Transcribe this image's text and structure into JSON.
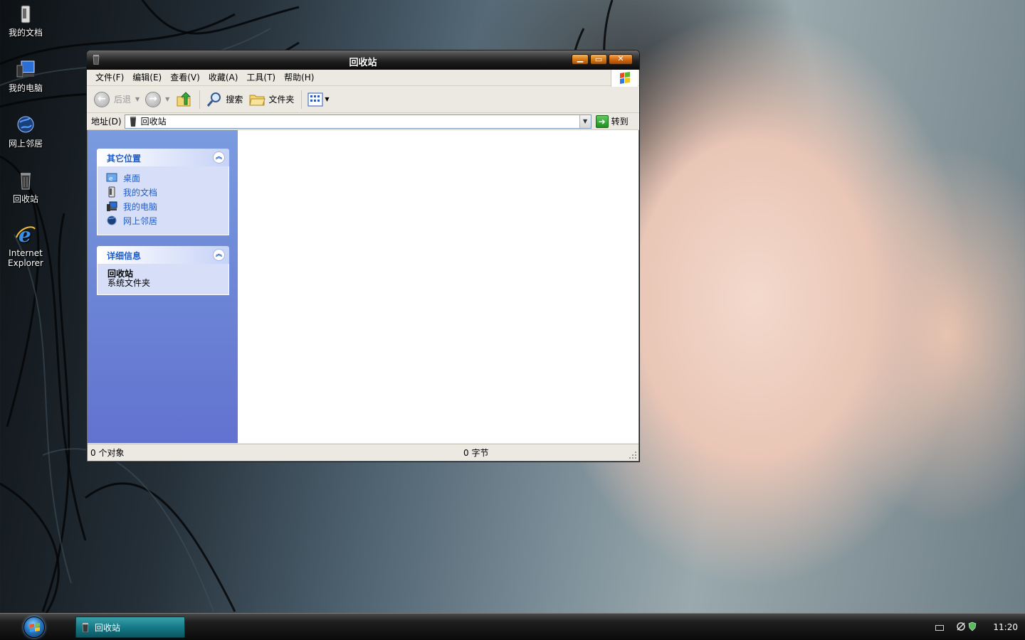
{
  "desktop": {
    "icons": [
      {
        "label": "我的文档"
      },
      {
        "label": "我的电脑"
      },
      {
        "label": "网上邻居"
      },
      {
        "label": "回收站"
      },
      {
        "label": "Internet\nExplorer"
      }
    ]
  },
  "window": {
    "title": "回收站",
    "menu": [
      "文件(F)",
      "编辑(E)",
      "查看(V)",
      "收藏(A)",
      "工具(T)",
      "帮助(H)"
    ],
    "toolbar": {
      "back_label": "后退",
      "search_label": "搜索",
      "folders_label": "文件夹"
    },
    "address": {
      "label": "地址(D)",
      "value": "回收站",
      "go_label": "转到"
    },
    "left_pane": {
      "other_places": {
        "title": "其它位置",
        "links": [
          "桌面",
          "我的文档",
          "我的电脑",
          "网上邻居"
        ]
      },
      "details": {
        "title": "详细信息",
        "name": "回收站",
        "type": "系统文件夹"
      }
    },
    "status": {
      "objects": "0 个对象",
      "size": "0 字节"
    }
  },
  "taskbar": {
    "task_label": "回收站",
    "clock": "11:20"
  },
  "colors": {
    "panel_link": "#215dc6",
    "left_pane": "#6a82d4",
    "task_button": "#157a88"
  }
}
